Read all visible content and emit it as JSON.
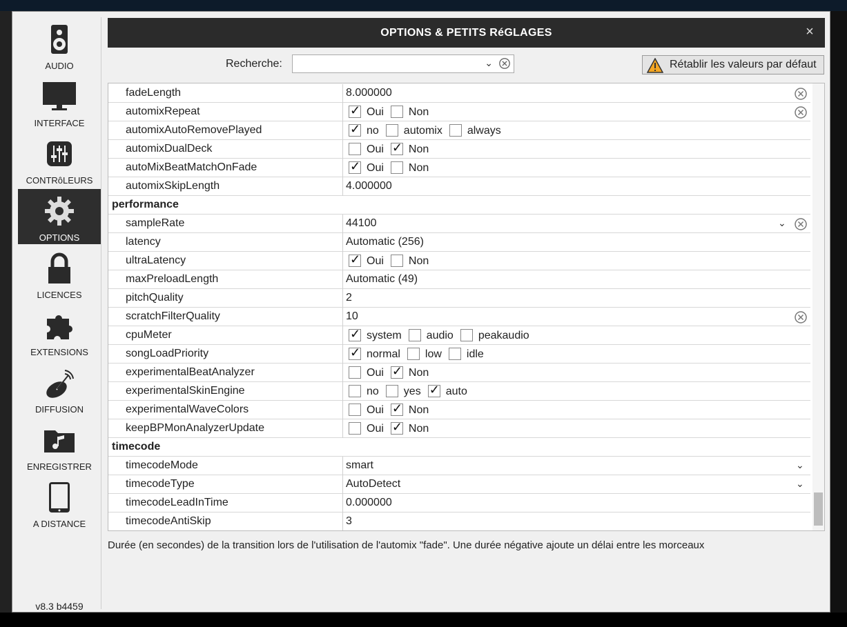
{
  "dialog": {
    "title": "OPTIONS & PETITS RéGLAGES",
    "close_label": "×",
    "search_label": "Recherche:",
    "search_value": "",
    "reset_label": "Rétablir les valeurs par défaut",
    "description": "Durée (en secondes) de la transition lors de l'utilisation de l'automix \"fade\". Une durée négative ajoute un délai entre les morceaux",
    "version": "v8.3 b4459"
  },
  "sidebar": {
    "items": [
      {
        "label": "AUDIO",
        "icon": "speaker-icon"
      },
      {
        "label": "INTERFACE",
        "icon": "monitor-icon"
      },
      {
        "label": "CONTRôLEURS",
        "icon": "sliders-icon"
      },
      {
        "label": "OPTIONS",
        "icon": "gear-icon",
        "active": true
      },
      {
        "label": "LICENCES",
        "icon": "lock-icon"
      },
      {
        "label": "EXTENSIONS",
        "icon": "puzzle-icon"
      },
      {
        "label": "DIFFUSION",
        "icon": "satellite-dish-icon"
      },
      {
        "label": "ENREGISTRER",
        "icon": "music-folder-icon"
      },
      {
        "label": "A DISTANCE",
        "icon": "tablet-icon"
      }
    ]
  },
  "rows": {
    "r0": {
      "key": "fadeLength",
      "value": "8.000000"
    },
    "r1": {
      "key": "automixRepeat",
      "o1": "Oui",
      "o2": "Non"
    },
    "r2": {
      "key": "automixAutoRemovePlayed",
      "o1": "no",
      "o2": "automix",
      "o3": "always"
    },
    "r3": {
      "key": "automixDualDeck",
      "o1": "Oui",
      "o2": "Non"
    },
    "r4": {
      "key": "autoMixBeatMatchOnFade",
      "o1": "Oui",
      "o2": "Non"
    },
    "r5": {
      "key": "automixSkipLength",
      "value": "4.000000"
    },
    "s1": {
      "key": "performance"
    },
    "r6": {
      "key": "sampleRate",
      "value": "44100"
    },
    "r7": {
      "key": "latency",
      "value": "Automatic (256)"
    },
    "r8": {
      "key": "ultraLatency",
      "o1": "Oui",
      "o2": "Non"
    },
    "r9": {
      "key": "maxPreloadLength",
      "value": "Automatic (49)"
    },
    "r10": {
      "key": "pitchQuality",
      "value": "2"
    },
    "r11": {
      "key": "scratchFilterQuality",
      "value": "10"
    },
    "r12": {
      "key": "cpuMeter",
      "o1": "system",
      "o2": "audio",
      "o3": "peakaudio"
    },
    "r13": {
      "key": "songLoadPriority",
      "o1": "normal",
      "o2": "low",
      "o3": "idle"
    },
    "r14": {
      "key": "experimentalBeatAnalyzer",
      "o1": "Oui",
      "o2": "Non"
    },
    "r15": {
      "key": "experimentalSkinEngine",
      "o1": "no",
      "o2": "yes",
      "o3": "auto"
    },
    "r16": {
      "key": "experimentalWaveColors",
      "o1": "Oui",
      "o2": "Non"
    },
    "r17": {
      "key": "keepBPMonAnalyzerUpdate",
      "o1": "Oui",
      "o2": "Non"
    },
    "s2": {
      "key": "timecode"
    },
    "r18": {
      "key": "timecodeMode",
      "value": "smart"
    },
    "r19": {
      "key": "timecodeType",
      "value": "AutoDetect"
    },
    "r20": {
      "key": "timecodeLeadInTime",
      "value": "0.000000"
    },
    "r21": {
      "key": "timecodeAntiSkip",
      "value": "3"
    }
  },
  "colors": {
    "titlebar": "#2b2b2b",
    "active_sidebar": "#2e2e2e",
    "warning": "#f5a623"
  }
}
